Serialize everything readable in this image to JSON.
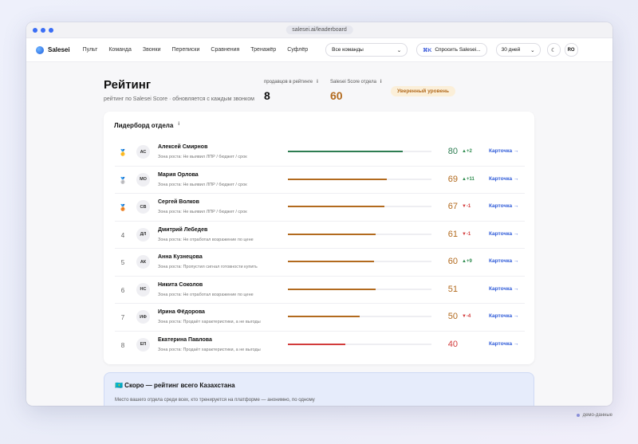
{
  "browser": {
    "url": "salesei.ai/leaderboard"
  },
  "nav": {
    "brand": "Salesei",
    "links": [
      "Пульт",
      "Команда",
      "Звонки",
      "Переписки",
      "Сравнения",
      "Тренажёр",
      "Суфлёр"
    ],
    "team_select": "Все команды",
    "ask_kbd": "⌘K",
    "ask_label": "Спросить Salesei...",
    "period_select": "30 дней",
    "avatar": "RO"
  },
  "header": {
    "title": "Рейтинг",
    "subtitle": "рейтинг по Salesei Score · обновляется с каждым звонком",
    "stat_sellers_label": "продавцов в рейтинге",
    "stat_sellers_value": "8",
    "stat_score_label": "Salesei Score отдела",
    "stat_score_value": "60",
    "level_badge": "Уверенный уровень"
  },
  "leaderboard": {
    "title": "Лидерборд отдела",
    "link_label": "Карточка →",
    "rows": [
      {
        "rank": "🥇",
        "initials": "АС",
        "name": "Алексей Смирнов",
        "zone": "Зона роста: Не выявил ЛПР / бюджет / срок",
        "score": "80",
        "delta": "▲+2",
        "trend": "up",
        "fill": 0.8,
        "color": "#2e7d52"
      },
      {
        "rank": "🥈",
        "initials": "МО",
        "name": "Мария Орлова",
        "zone": "Зона роста: Не выявил ЛПР / бюджет / срок",
        "score": "69",
        "delta": "▲+11",
        "trend": "up",
        "fill": 0.69,
        "color": "#b26a1e"
      },
      {
        "rank": "🥉",
        "initials": "СВ",
        "name": "Сергей Волков",
        "zone": "Зона роста: Не выявил ЛПР / бюджет / срок",
        "score": "67",
        "delta": "▼-1",
        "trend": "down",
        "fill": 0.67,
        "color": "#b26a1e"
      },
      {
        "rank": "4",
        "initials": "ДЛ",
        "name": "Дмитрий Лебедев",
        "zone": "Зона роста: Не отработал возражение по цене",
        "score": "61",
        "delta": "▼-1",
        "trend": "down",
        "fill": 0.61,
        "color": "#b26a1e"
      },
      {
        "rank": "5",
        "initials": "АК",
        "name": "Анна Кузнецова",
        "zone": "Зона роста: Пропустил сигнал готовности купить",
        "score": "60",
        "delta": "▲+9",
        "trend": "up",
        "fill": 0.6,
        "color": "#b26a1e"
      },
      {
        "rank": "6",
        "initials": "НС",
        "name": "Никита Соколов",
        "zone": "Зона роста: Не отработал возражение по цене",
        "score": "51",
        "delta": "",
        "trend": "none",
        "fill": 0.61,
        "color": "#b26a1e"
      },
      {
        "rank": "7",
        "initials": "ИФ",
        "name": "Ирина Фёдорова",
        "zone": "Зона роста: Продаёт характеристики, а не выгоды",
        "score": "50",
        "delta": "▼-4",
        "trend": "down",
        "fill": 0.5,
        "color": "#b26a1e"
      },
      {
        "rank": "8",
        "initials": "ЕП",
        "name": "Екатерина Павлова",
        "zone": "Зона роста: Продаёт характеристики, а не выгоды",
        "score": "40",
        "delta": "",
        "trend": "none",
        "fill": 0.4,
        "color": "#d23b3b"
      }
    ]
  },
  "soon": {
    "title": "🇰🇿 Скоро — рейтинг всего Казахстана",
    "text": "Место вашего отдела среди всех, кто тренируется на платформе — анонимно, по одному"
  },
  "footer": {
    "demo": "демо-данные"
  }
}
